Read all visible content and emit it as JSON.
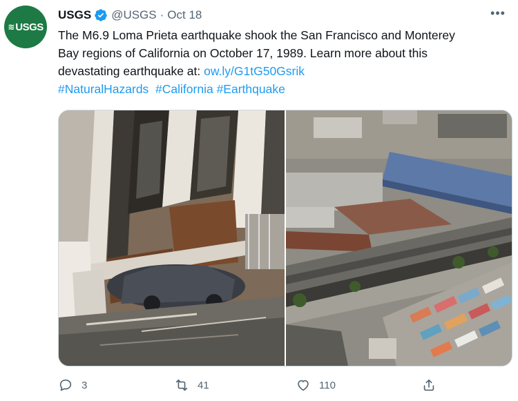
{
  "account": {
    "avatar_text": "USGS",
    "name": "USGS",
    "handle": "@USGS",
    "separator": "·",
    "date": "Oct 18"
  },
  "more_label": "•••",
  "tweet": {
    "line1": "The M6.9 Loma Prieta earthquake shook the San Francisco and Monterey",
    "line2": "Bay regions of California on October 17, 1989. Learn more about this",
    "line3_text": "devastating earthquake at: ",
    "link": "ow.ly/G1tG50Gsrik",
    "hashtags": [
      "#NaturalHazards",
      "#California",
      "#Earthquake"
    ]
  },
  "actions": {
    "replies": "3",
    "retweets": "41",
    "likes": "110"
  },
  "colors": {
    "accent": "#1d9bf0",
    "avatar_bg": "#1d7a44",
    "muted": "#536471"
  }
}
